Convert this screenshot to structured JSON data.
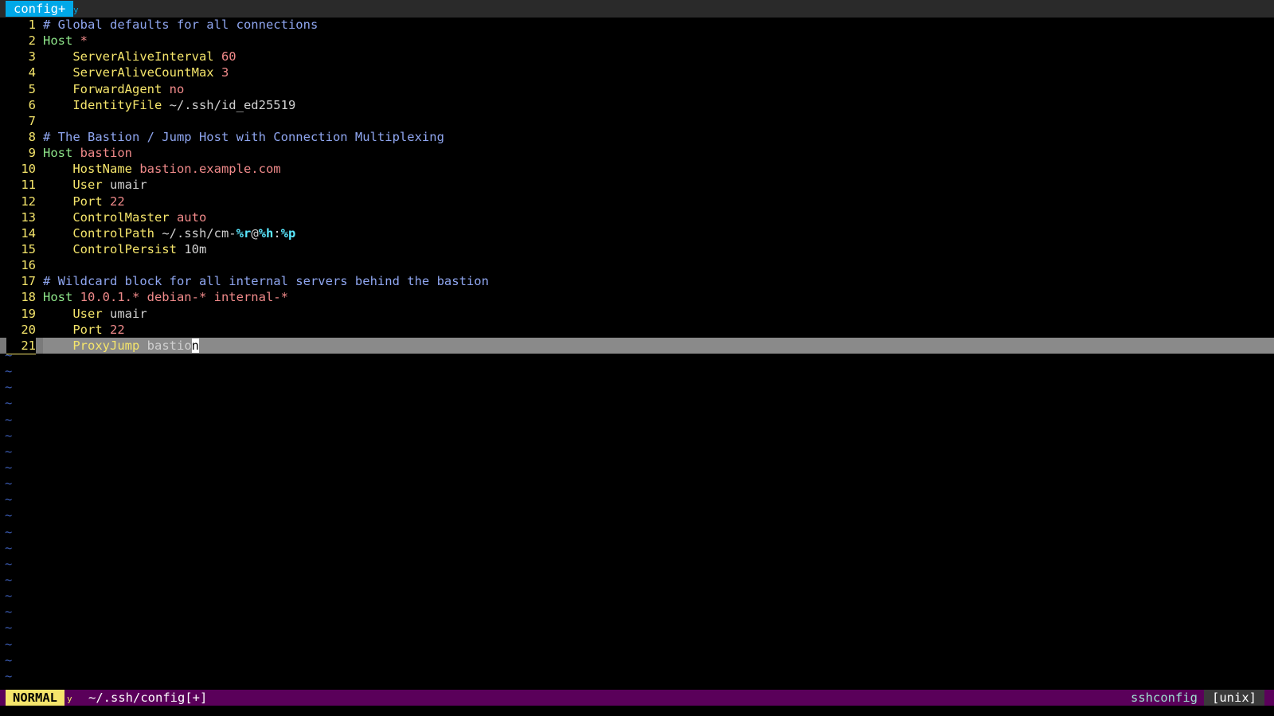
{
  "tabline": {
    "active_tab": "config+"
  },
  "lines": [
    {
      "num": "1",
      "parts": [
        {
          "t": "# Global defaults for all connections",
          "c": "c-comment"
        }
      ]
    },
    {
      "num": "2",
      "parts": [
        {
          "t": "Host",
          "c": "c-host"
        },
        {
          "t": " *",
          "c": "c-val"
        }
      ]
    },
    {
      "num": "3",
      "parts": [
        {
          "t": "    ServerAliveInterval",
          "c": "c-key"
        },
        {
          "t": " 60",
          "c": "c-val"
        }
      ]
    },
    {
      "num": "4",
      "parts": [
        {
          "t": "    ServerAliveCountMax",
          "c": "c-key"
        },
        {
          "t": " 3",
          "c": "c-val"
        }
      ]
    },
    {
      "num": "5",
      "parts": [
        {
          "t": "    ForwardAgent",
          "c": "c-key"
        },
        {
          "t": " no",
          "c": "c-val"
        }
      ]
    },
    {
      "num": "6",
      "parts": [
        {
          "t": "    IdentityFile",
          "c": "c-key"
        },
        {
          "t": " ~/.ssh/id_ed25519",
          "c": "c-plain"
        }
      ]
    },
    {
      "num": "7",
      "parts": []
    },
    {
      "num": "8",
      "parts": [
        {
          "t": "# The Bastion / Jump Host with Connection Multiplexing",
          "c": "c-comment"
        }
      ]
    },
    {
      "num": "9",
      "parts": [
        {
          "t": "Host",
          "c": "c-host"
        },
        {
          "t": " bastion",
          "c": "c-val"
        }
      ]
    },
    {
      "num": "10",
      "parts": [
        {
          "t": "    HostName",
          "c": "c-key"
        },
        {
          "t": " bastion.example.com",
          "c": "c-val"
        }
      ]
    },
    {
      "num": "11",
      "parts": [
        {
          "t": "    User",
          "c": "c-key"
        },
        {
          "t": " umair",
          "c": "c-plain"
        }
      ]
    },
    {
      "num": "12",
      "parts": [
        {
          "t": "    Port",
          "c": "c-key"
        },
        {
          "t": " 22",
          "c": "c-val"
        }
      ]
    },
    {
      "num": "13",
      "parts": [
        {
          "t": "    ControlMaster",
          "c": "c-key"
        },
        {
          "t": " auto",
          "c": "c-val"
        }
      ]
    },
    {
      "num": "14",
      "parts": [
        {
          "t": "    ControlPath",
          "c": "c-key"
        },
        {
          "t": " ~/.ssh/cm-",
          "c": "c-plain"
        },
        {
          "t": "%r",
          "c": "c-fmt"
        },
        {
          "t": "@",
          "c": "c-plain"
        },
        {
          "t": "%h",
          "c": "c-fmt"
        },
        {
          "t": ":",
          "c": "c-plain"
        },
        {
          "t": "%p",
          "c": "c-fmt"
        }
      ]
    },
    {
      "num": "15",
      "parts": [
        {
          "t": "    ControlPersist",
          "c": "c-key"
        },
        {
          "t": " 10m",
          "c": "c-plain"
        }
      ]
    },
    {
      "num": "16",
      "parts": []
    },
    {
      "num": "17",
      "parts": [
        {
          "t": "# Wildcard block for all internal servers behind the bastion",
          "c": "c-comment"
        }
      ]
    },
    {
      "num": "18",
      "parts": [
        {
          "t": "Host",
          "c": "c-host"
        },
        {
          "t": " 10.0.1.* debian-* internal-*",
          "c": "c-val"
        }
      ]
    },
    {
      "num": "19",
      "parts": [
        {
          "t": "    User",
          "c": "c-key"
        },
        {
          "t": " umair",
          "c": "c-plain"
        }
      ]
    },
    {
      "num": "20",
      "parts": [
        {
          "t": "    Port",
          "c": "c-key"
        },
        {
          "t": " 22",
          "c": "c-val"
        }
      ]
    },
    {
      "num": "21",
      "parts": [
        {
          "t": "    ProxyJump",
          "c": "c-key"
        },
        {
          "t": " bastio",
          "c": "c-plain"
        },
        {
          "t": "n",
          "c": "cursor"
        }
      ],
      "cursorline": true
    }
  ],
  "tilde_char": "~",
  "tilde_count": 21,
  "statusline": {
    "mode": "NORMAL",
    "filepath": "~/.ssh/config[+]",
    "filetype": "sshconfig",
    "fileformat": "[unix]"
  },
  "colors": {
    "tab_active_bg": "#00a8e8",
    "line_number": "#f5e56b",
    "comment": "#8fa6f0",
    "host_keyword": "#8ee68a",
    "option_key": "#f5e56b",
    "value": "#f08a8a",
    "statusline_bg": "#5a005a",
    "mode_bg": "#f5e56b"
  }
}
